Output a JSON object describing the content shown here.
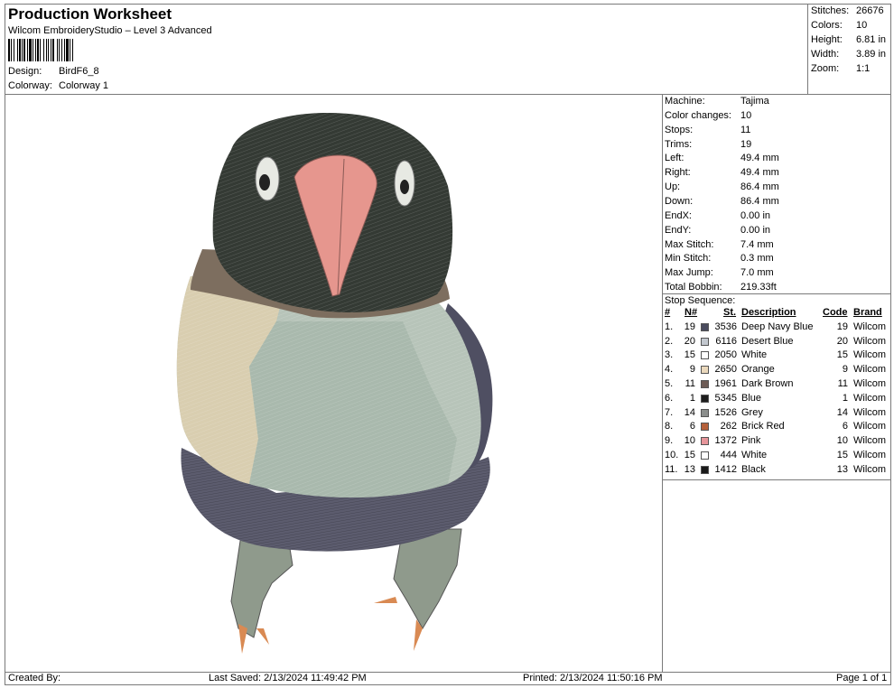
{
  "header": {
    "title": "Production Worksheet",
    "subtitle": "Wilcom EmbroideryStudio – Level 3 Advanced",
    "design_label": "Design:",
    "design_value": "BirdF6_8",
    "colorway_label": "Colorway:",
    "colorway_value": "Colorway 1"
  },
  "summary": [
    {
      "label": "Stitches:",
      "value": "26676"
    },
    {
      "label": "Colors:",
      "value": "10"
    },
    {
      "label": "Height:",
      "value": "6.81 in"
    },
    {
      "label": "Width:",
      "value": "3.89 in"
    },
    {
      "label": "Zoom:",
      "value": "1:1"
    }
  ],
  "machine_info": [
    {
      "label": "Machine:",
      "value": "Tajima"
    },
    {
      "label": "Color changes:",
      "value": "10"
    },
    {
      "label": "Stops:",
      "value": "11"
    },
    {
      "label": "Trims:",
      "value": "19"
    },
    {
      "label": "Left:",
      "value": "49.4 mm"
    },
    {
      "label": "Right:",
      "value": "49.4 mm"
    },
    {
      "label": "Up:",
      "value": "86.4 mm"
    },
    {
      "label": "Down:",
      "value": "86.4 mm"
    },
    {
      "label": "EndX:",
      "value": "0.00 in"
    },
    {
      "label": "EndY:",
      "value": "0.00 in"
    },
    {
      "label": "Max Stitch:",
      "value": "7.4 mm"
    },
    {
      "label": "Min Stitch:",
      "value": "0.3 mm"
    },
    {
      "label": "Max Jump:",
      "value": "7.0 mm"
    },
    {
      "label": "Total Bobbin:",
      "value": "219.33ft"
    }
  ],
  "stop_sequence": {
    "title": "Stop Sequence:",
    "headers": {
      "idx": "#",
      "n": "N#",
      "st": "St.",
      "desc": "Description",
      "code": "Code",
      "brand": "Brand"
    },
    "rows": [
      {
        "idx": "1.",
        "n": "19",
        "color": "#4a4c5e",
        "st": "3536",
        "desc": "Deep Navy Blue",
        "code": "19",
        "brand": "Wilcom"
      },
      {
        "idx": "2.",
        "n": "20",
        "color": "#c3c8cf",
        "st": "6116",
        "desc": "Desert Blue",
        "code": "20",
        "brand": "Wilcom"
      },
      {
        "idx": "3.",
        "n": "15",
        "color": "#ffffff",
        "st": "2050",
        "desc": "White",
        "code": "15",
        "brand": "Wilcom"
      },
      {
        "idx": "4.",
        "n": "9",
        "color": "#ead8bc",
        "st": "2650",
        "desc": "Orange",
        "code": "9",
        "brand": "Wilcom"
      },
      {
        "idx": "5.",
        "n": "11",
        "color": "#6d5c56",
        "st": "1961",
        "desc": "Dark Brown",
        "code": "11",
        "brand": "Wilcom"
      },
      {
        "idx": "6.",
        "n": "1",
        "color": "#1e1e1e",
        "st": "5345",
        "desc": "Blue",
        "code": "1",
        "brand": "Wilcom"
      },
      {
        "idx": "7.",
        "n": "14",
        "color": "#8b8e8c",
        "st": "1526",
        "desc": "Grey",
        "code": "14",
        "brand": "Wilcom"
      },
      {
        "idx": "8.",
        "n": "6",
        "color": "#b5603a",
        "st": "262",
        "desc": "Brick Red",
        "code": "6",
        "brand": "Wilcom"
      },
      {
        "idx": "9.",
        "n": "10",
        "color": "#e6959a",
        "st": "1372",
        "desc": "Pink",
        "code": "10",
        "brand": "Wilcom"
      },
      {
        "idx": "10.",
        "n": "15",
        "color": "#ffffff",
        "st": "444",
        "desc": "White",
        "code": "15",
        "brand": "Wilcom"
      },
      {
        "idx": "11.",
        "n": "13",
        "color": "#1a1a1a",
        "st": "1412",
        "desc": "Black",
        "code": "13",
        "brand": "Wilcom"
      }
    ]
  },
  "footer": {
    "created_by": "Created By:",
    "last_saved": "Last Saved: 2/13/2024 11:49:42 PM",
    "printed": "Printed: 2/13/2024 11:50:16 PM",
    "page": "Page 1 of 1"
  }
}
